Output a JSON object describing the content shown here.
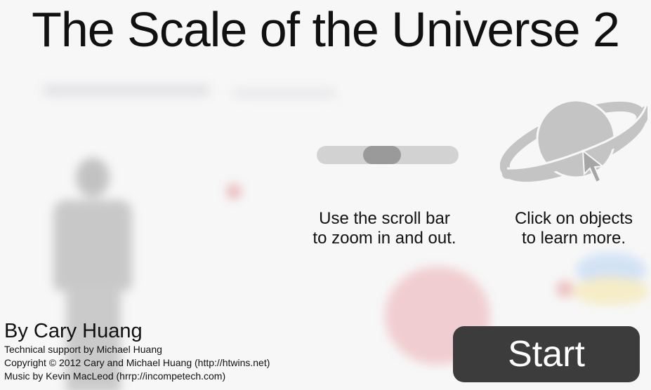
{
  "title": "The Scale of the Universe 2",
  "instructions": {
    "scroll_line1": "Use the scroll bar",
    "scroll_line2": "to zoom in and out.",
    "click_line1": "Click on objects",
    "click_line2": "to learn more."
  },
  "credits": {
    "author": "By Cary Huang",
    "technical": "Technical support by Michael Huang",
    "copyright": "Copyright © 2012 Cary and Michael Huang (http://htwins.net)",
    "music": "Music by Kevin MacLeod (hrrp://incompetech.com)"
  },
  "start_button": {
    "label": "Start"
  },
  "colors": {
    "button_bg": "#3c3c3c",
    "track": "#d2d2d2",
    "thumb": "#9a9a9a",
    "planet": "#c4c4c4"
  },
  "icons": {
    "planet": "planet-icon",
    "cursor": "cursor-icon"
  }
}
